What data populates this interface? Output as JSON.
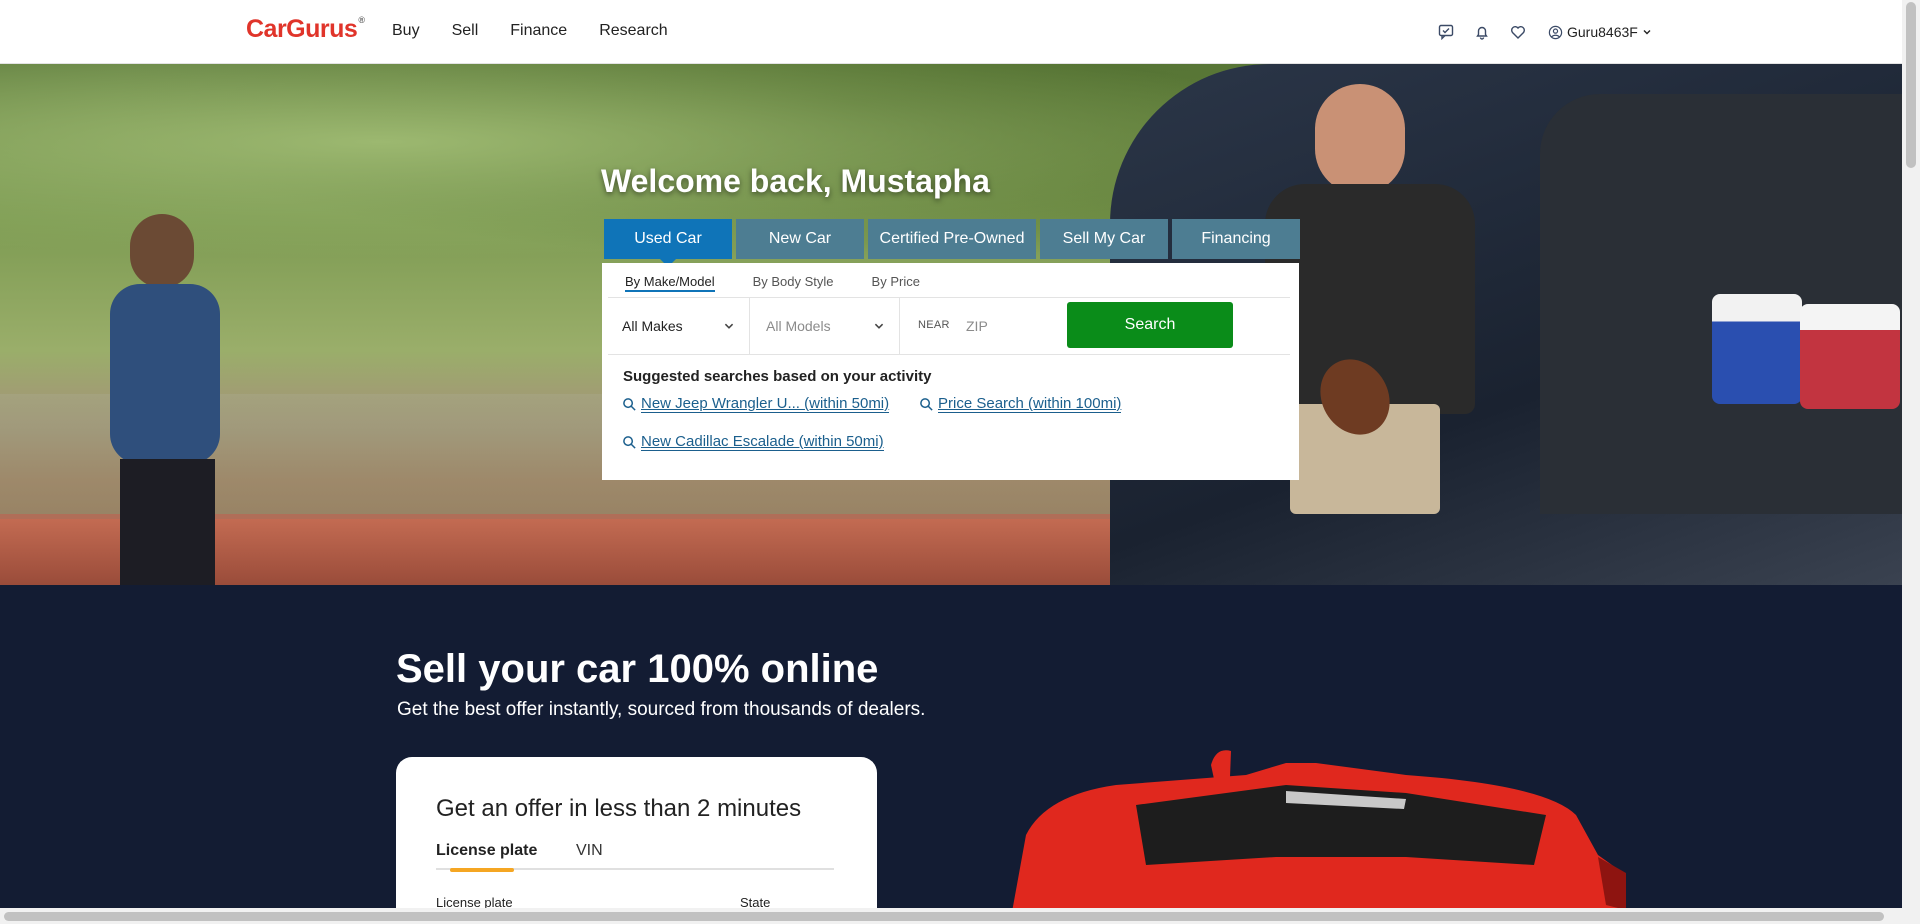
{
  "header": {
    "logo": "CarGurus",
    "logo_mark": "®",
    "nav": [
      "Buy",
      "Sell",
      "Finance",
      "Research"
    ],
    "username": "Guru8463F"
  },
  "hero": {
    "welcome": "Welcome back, Mustapha",
    "tabs": [
      "Used Car",
      "New Car",
      "Certified Pre-Owned",
      "Sell My Car",
      "Financing"
    ],
    "subtabs": [
      "By Make/Model",
      "By Body Style",
      "By Price"
    ],
    "makes_selected": "All Makes",
    "models_selected": "All Models",
    "near_label": "NEAR",
    "zip_placeholder": "ZIP",
    "search_label": "Search",
    "suggested_title": "Suggested searches based on your activity",
    "suggestions": [
      "New Jeep Wrangler U... (within 50mi)",
      "Price Search (within 100mi)",
      "New Cadillac Escalade (within 50mi)"
    ]
  },
  "sell": {
    "heading": "Sell your car 100% online",
    "subheading": "Get the best offer instantly, sourced from thousands of dealers.",
    "card_title": "Get an offer in less than 2 minutes",
    "card_tabs": [
      "License plate",
      "VIN"
    ],
    "field_labels": [
      "License plate",
      "State"
    ]
  },
  "colors": {
    "brand_red": "#e0342a",
    "tab_active": "#0f74b8",
    "tab_inactive": "#4d7d92",
    "search_button": "#0a8c19",
    "link": "#1b5f8d",
    "sell_bg": "#131c33",
    "accent_orange": "#f5a623"
  }
}
